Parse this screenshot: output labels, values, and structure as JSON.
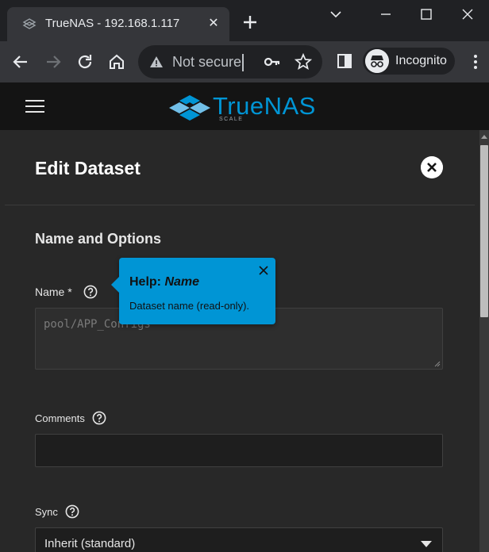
{
  "browser": {
    "tab_title": "TrueNAS - 192.168.1.117",
    "tab_close": "✕",
    "omnibox_text": "Not secure",
    "profile_label": "Incognito"
  },
  "app": {
    "logo_text": "TrueNAS",
    "logo_subtext": "SCALE"
  },
  "panel": {
    "title": "Edit Dataset",
    "section_title": "Name and Options",
    "fields": {
      "name": {
        "label": "Name *",
        "value": "pool/APP_Configs"
      },
      "comments": {
        "label": "Comments",
        "value": ""
      },
      "sync": {
        "label": "Sync",
        "value": "Inherit (standard)"
      }
    }
  },
  "tooltip": {
    "prefix": "Help: ",
    "field": "Name",
    "body": "Dataset name (read-only)."
  },
  "colors": {
    "accent": "#0095d5",
    "background": "#282828",
    "header": "#141414"
  }
}
